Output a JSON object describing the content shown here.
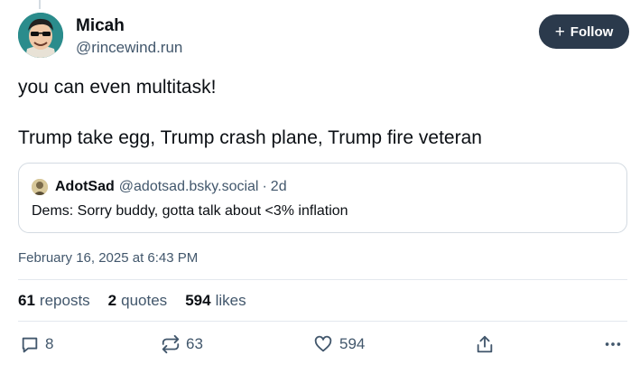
{
  "post": {
    "author": {
      "display_name": "Micah",
      "handle": "@rincewind.run"
    },
    "follow_label": "Follow",
    "text_line1": "you can even multitask!",
    "text_line2": "Trump take egg, Trump crash plane, Trump fire veteran",
    "timestamp": "February 16, 2025 at 6:43 PM"
  },
  "quote": {
    "display_name": "AdotSad",
    "handle": "@adotsad.bsky.social",
    "separator": "·",
    "time": "2d",
    "text": "Dems: Sorry buddy, gotta talk about <3% inflation"
  },
  "stats": {
    "reposts": {
      "count": "61",
      "label": "reposts"
    },
    "quotes": {
      "count": "2",
      "label": "quotes"
    },
    "likes": {
      "count": "594",
      "label": "likes"
    }
  },
  "actions": {
    "reply_count": "8",
    "repost_count": "63",
    "like_count": "594",
    "icons": [
      "reply-icon",
      "repost-icon",
      "like-icon",
      "share-icon",
      "more-icon"
    ]
  },
  "colors": {
    "text": "#0b0f14",
    "muted": "#42576c",
    "follow_bg": "#2b3a4c",
    "border": "#d4dbe2"
  }
}
